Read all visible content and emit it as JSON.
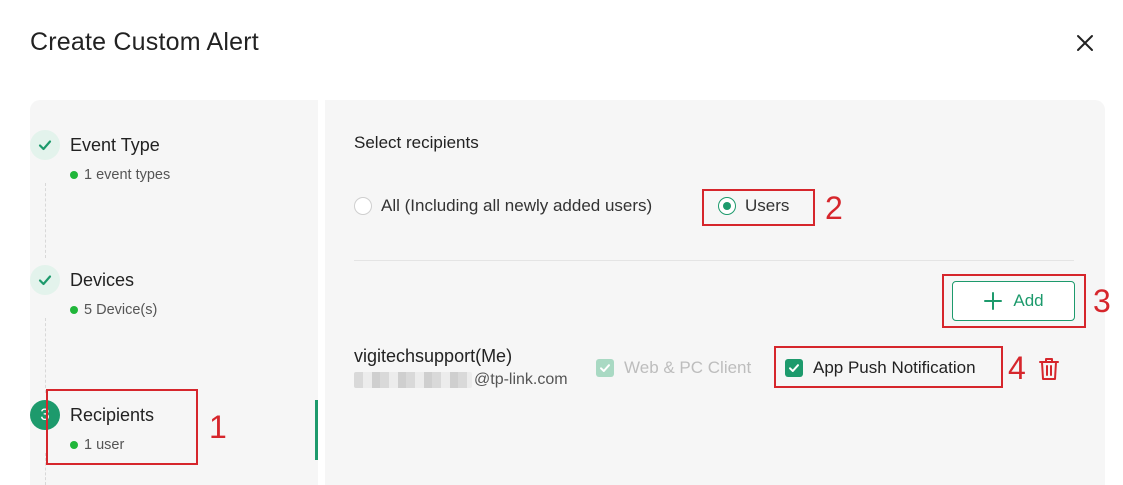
{
  "modal": {
    "title": "Create Custom Alert"
  },
  "steps": [
    {
      "title": "Event Type",
      "subtitle": "1 event types",
      "state": "done"
    },
    {
      "title": "Devices",
      "subtitle": "5 Device(s)",
      "state": "done"
    },
    {
      "number": "3",
      "title": "Recipients",
      "subtitle": "1 user",
      "state": "active"
    }
  ],
  "recipients": {
    "section_title": "Select recipients",
    "option_all": "All (Including all newly added users)",
    "option_users": "Users",
    "selected": "Users",
    "add_label": "Add"
  },
  "user": {
    "name": "vigitechsupport(Me)",
    "email_domain": "@tp-link.com",
    "web_client_label": "Web & PC Client",
    "app_push_label": "App Push Notification"
  },
  "annotations": [
    "1",
    "2",
    "3",
    "4"
  ],
  "colors": {
    "accent": "#1d9a6c",
    "annotation": "#d6262c",
    "status_dot": "#20b63a"
  },
  "icons": [
    "close-icon",
    "check-icon",
    "plus-icon",
    "trash-icon"
  ]
}
